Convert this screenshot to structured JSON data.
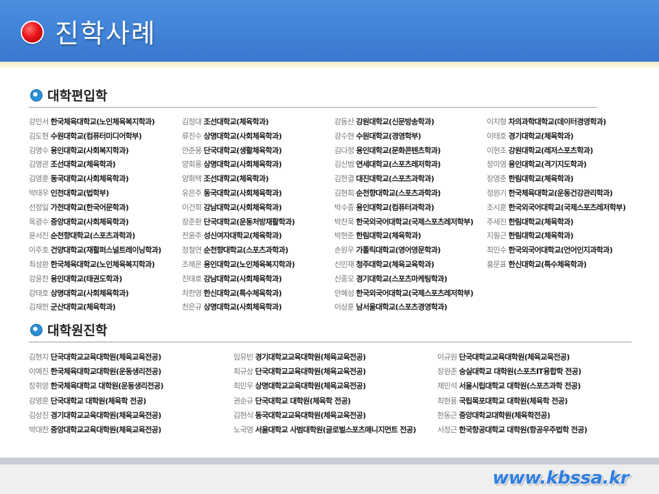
{
  "header": {
    "title": "진학사례"
  },
  "sections": [
    {
      "title": "대학편입학"
    },
    {
      "title": "대학원진학"
    }
  ],
  "transfer_cols": [
    [
      {
        "name": "강민서",
        "school": "한국체육대학교(노인체육복지학과)"
      },
      {
        "name": "김도현",
        "school": "수원대학교(컴퓨터미디어학부)"
      },
      {
        "name": "김명수",
        "school": "용인대학교(사회복지학과)"
      },
      {
        "name": "김명관",
        "school": "조선대학교(체육학과)"
      },
      {
        "name": "김영훈",
        "school": "동국대학교(사회체육학과)"
      },
      {
        "name": "박태우",
        "school": "인천대학교(법학부)"
      },
      {
        "name": "선정일",
        "school": "가천대학교(한국어문학과)"
      },
      {
        "name": "옥광수",
        "school": "중앙대학교(사회체육학과)"
      },
      {
        "name": "윤서진",
        "school": "순천향대학교(스포츠과학과)"
      },
      {
        "name": "이주호",
        "school": "건양대학교(재활퍼스널트레이닝학과)"
      },
      {
        "name": "최성환",
        "school": "한국체육대학교(노인체육복지학과)"
      },
      {
        "name": "강윤찬",
        "school": "용인대학교(태권도학과)"
      },
      {
        "name": "강태호",
        "school": "상명대학교(사회체육학과)"
      },
      {
        "name": "김재헌",
        "school": "군산대학교(체육학과)"
      }
    ],
    [
      {
        "name": "김정대",
        "school": "조선대학교(체육학과)"
      },
      {
        "name": "류진수",
        "school": "상명대학교(사회체육학과)"
      },
      {
        "name": "안준용",
        "school": "단국대학교(생활체육학과)"
      },
      {
        "name": "양회용",
        "school": "상명대학교(사회체육학과)"
      },
      {
        "name": "양회택",
        "school": "조선대학교(체육학과)"
      },
      {
        "name": "유은주",
        "school": "동국대학교(사회체육학과)"
      },
      {
        "name": "이건희",
        "school": "강남대학교(사회체육학과)"
      },
      {
        "name": "장준환",
        "school": "단국대학교(운동처방재활학과)"
      },
      {
        "name": "전윤주",
        "school": "성신여자대학교(체육학과)"
      },
      {
        "name": "정철연",
        "school": "순천향대학교(스포츠과학과)"
      },
      {
        "name": "조해온",
        "school": "용인대학교(노인체육복지학과)"
      },
      {
        "name": "진태호",
        "school": "강남대학교(사회체육학과)"
      },
      {
        "name": "차한영",
        "school": "한신대학교(특수체육학과)"
      },
      {
        "name": "천은규",
        "school": "상명대학교(사회체육학과)"
      }
    ],
    [
      {
        "name": "강동산",
        "school": "강원대학교(신문방송학과)"
      },
      {
        "name": "강수현",
        "school": "수원대학교(경영학부)"
      },
      {
        "name": "김다정",
        "school": "용인대학교(문화콘텐츠학과)"
      },
      {
        "name": "김신범",
        "school": "연세대학교(스포츠레저학과)"
      },
      {
        "name": "김한결",
        "school": "대진대학교(스포츠과학과)"
      },
      {
        "name": "김현회",
        "school": "순천향대학교(스포츠과학과)"
      },
      {
        "name": "박수종",
        "school": "용인대학교(컴퓨터과학과)"
      },
      {
        "name": "박찬욱",
        "school": "한국외국어대학교(국제스포츠레저학부)"
      },
      {
        "name": "박현준",
        "school": "한림대학교(체육학과)"
      },
      {
        "name": "손원우",
        "school": "가톨릭대학교(영어영문학과)"
      },
      {
        "name": "신민재",
        "school": "청주대학교(체육교육학과)"
      },
      {
        "name": "신종오",
        "school": "경기대학교(스포츠마케팅학과)"
      },
      {
        "name": "안혜성",
        "school": "한국외국어대학교(국제스포츠레저학부)"
      },
      {
        "name": "이상훈",
        "school": "남서울대학교(스포츠경영학과)"
      }
    ],
    [
      {
        "name": "이지형",
        "school": "차의과학대학교(데이터경영학과)"
      },
      {
        "name": "이태호",
        "school": "경기대학교(체육학과)"
      },
      {
        "name": "이현조",
        "school": "강원대학교(레저스포츠학과)"
      },
      {
        "name": "장미영",
        "school": "용인대학교(격기지도학과)"
      },
      {
        "name": "장영준",
        "school": "한림대학교(체육학과)"
      },
      {
        "name": "정원기",
        "school": "한국체육대학교(운동건강관리학과)"
      },
      {
        "name": "조시훈",
        "school": "한국외국어대학교(국제스포츠레저학부)"
      },
      {
        "name": "주세진",
        "school": "한림대학교(체육학과)"
      },
      {
        "name": "지필근",
        "school": "한림대학교(체육학과)"
      },
      {
        "name": "최민수",
        "school": "한국외국어대학교(언어인지과학과)"
      },
      {
        "name": "홍문표",
        "school": "한신대학교(특수체육학과)"
      }
    ]
  ],
  "grad_cols": [
    [
      {
        "name": "김현지",
        "school": "단국대학교교육대학원(체육교육전공)"
      },
      {
        "name": "이예진",
        "school": "한국체육대학교대학원(운동생리전공)"
      },
      {
        "name": "장휘양",
        "school": "한국체육대학교 대학원(운동생리전공)"
      },
      {
        "name": "강영훈",
        "school": "단국대학교 대학원(체육학 전공)"
      },
      {
        "name": "김상진",
        "school": "경기대학교교육대학원(체육교육전공)"
      },
      {
        "name": "박대찬",
        "school": "중앙대학교교육대학원(체육교육전공)"
      }
    ],
    [
      {
        "name": "임유빈",
        "school": "경기대학교교육대학원(체육교육전공)"
      },
      {
        "name": "최규상",
        "school": "단국대학교교육대학원(체육교육전공)"
      },
      {
        "name": "최민우",
        "school": "상명대학교교육대학원(체육교육전공)"
      },
      {
        "name": "권순규",
        "school": "단국대학교 대학원(체육학 전공)"
      },
      {
        "name": "김현식",
        "school": "동국대학교교육대학원(체육교육전공)"
      },
      {
        "name": "노국영",
        "school": "서울대학교 사범대학원(글로벌스포츠매니지먼트 전공)"
      }
    ],
    [
      {
        "name": "이규원",
        "school": "단국대학교교육대학원(체육교육전공)"
      },
      {
        "name": "장원준",
        "school": "숭실대학교 대학원(스포츠IT융합학  전공)"
      },
      {
        "name": "제민석",
        "school": "서울시립대학교 대학원(스포츠과학 전공)"
      },
      {
        "name": "최현용",
        "school": "국립목포대학교 대학원(체육학 전공)"
      },
      {
        "name": "한동근",
        "school": "중앙대학교대학원(체육학전공)"
      },
      {
        "name": "서정근",
        "school": "한국항공대학교 대학원(항공우주법학  전공)"
      }
    ]
  ],
  "footer": {
    "website": "www.kbssa.kr"
  },
  "colors": {
    "header_blue": "#3f82d8",
    "bullet_red": "#e8141b",
    "section_icon": "#2a8fd6",
    "website": "#2f7fe0"
  }
}
